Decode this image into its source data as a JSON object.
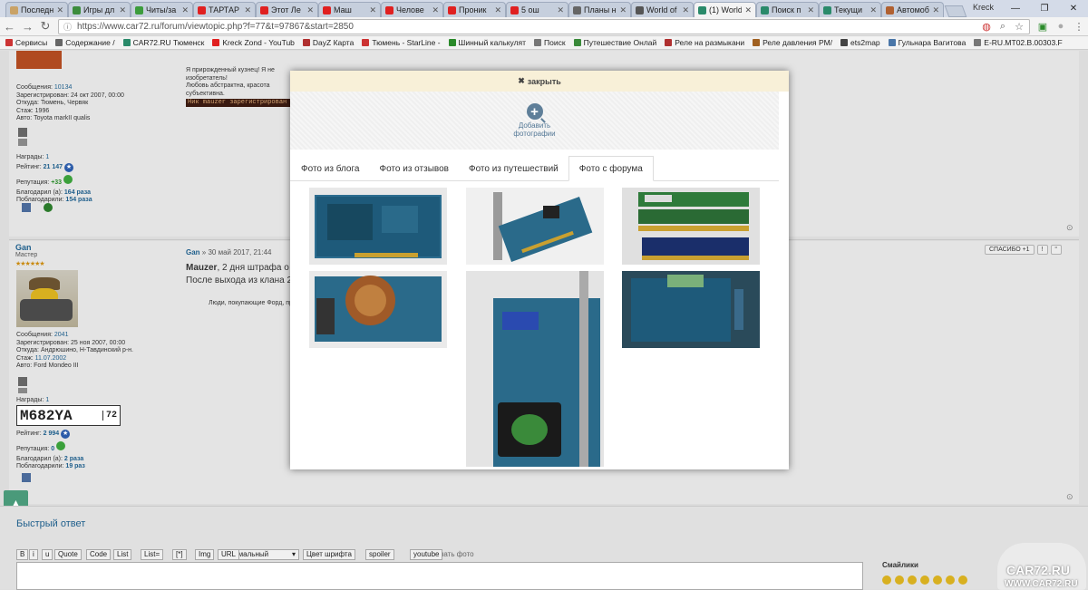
{
  "browser": {
    "tabs": [
      {
        "label": "Последн",
        "color": "#c9a266"
      },
      {
        "label": "Игры дл",
        "color": "#3c8c3c"
      },
      {
        "label": "Читы/за",
        "color": "#3c9c3c"
      },
      {
        "label": "ТАРТАР",
        "color": "#e02020"
      },
      {
        "label": "Этот Ле",
        "color": "#e02020"
      },
      {
        "label": "Маш",
        "color": "#e02020"
      },
      {
        "label": "Челове",
        "color": "#e02020"
      },
      {
        "label": "Проник",
        "color": "#e02020"
      },
      {
        "label": "5 ош",
        "color": "#e02020"
      },
      {
        "label": "Планы н",
        "color": "#666"
      },
      {
        "label": "World of",
        "color": "#555"
      },
      {
        "label": "(1) World",
        "color": "#2a8a6a"
      },
      {
        "label": "Поиск п",
        "color": "#2a8a6a"
      },
      {
        "label": "Текущи",
        "color": "#2a8a6a"
      },
      {
        "label": "Автомоб",
        "color": "#b06030"
      }
    ],
    "active_tab": 11,
    "profile": "Kreck",
    "url": "https://www.car72.ru/forum/viewtopic.php?f=77&t=97867&start=2850",
    "bookmarks": [
      {
        "label": "Сервисы",
        "color": "#c33"
      },
      {
        "label": "Содержание /",
        "color": "#666"
      },
      {
        "label": "CAR72.RU Тюменск",
        "color": "#2a8a6a"
      },
      {
        "label": "Kreck Zond - YouTub",
        "color": "#e02020"
      },
      {
        "label": "DayZ Карта",
        "color": "#b03030"
      },
      {
        "label": "Тюмень - StarLine -",
        "color": "#c33"
      },
      {
        "label": "Шинный калькулят",
        "color": "#2a8a2a"
      },
      {
        "label": "Поиск",
        "color": "#777"
      },
      {
        "label": "Путешествие Онлай",
        "color": "#3a8a3a"
      },
      {
        "label": "Реле на размыкани",
        "color": "#b03030"
      },
      {
        "label": "Реле давления РМ/",
        "color": "#a06020"
      },
      {
        "label": "ets2map",
        "color": "#444"
      },
      {
        "label": "Гульнара Вагитова",
        "color": "#4a76a8"
      },
      {
        "label": "E-RU.MT02.B.00303.F",
        "color": "#777"
      }
    ]
  },
  "forum": {
    "post1": {
      "sig1": "Я прирожденный кузнец! Я не изобретатель!",
      "sig2": "Любовь абстрактна, красота субъективна.",
      "sig3": "Ник mauzer зарегистрирован",
      "messages_label": "Сообщения:",
      "messages": "10134",
      "registered_label": "Зарегистрирован:",
      "registered": "24 окт 2007, 00:00",
      "from_label": "Откуда:",
      "from": "Тюмень, Червяк",
      "exp_label": "Стаж:",
      "exp": "1996",
      "car_label": "Авто:",
      "car": "Toyota markII qualis",
      "awards_label": "Награды:",
      "awards": "1",
      "rating_label": "Рейтинг:",
      "rating": "21 147",
      "rep_label": "Репутация:",
      "rep": "+33",
      "thanked_label": "Благодарил (а):",
      "thanked": "164 раза",
      "got_label": "Поблагодарили:",
      "got": "154 раза"
    },
    "post2": {
      "author": "Gan",
      "rank": "Мастер",
      "date": "» 30 май 2017, 21:44",
      "quote_author": "Mauzer",
      "line1": ", 2 дня штрафа о",
      "line2": "После выхода из клана 2",
      "sig": "Люди, покупающие Форд, прост",
      "messages_label": "Сообщения:",
      "messages": "2041",
      "registered_label": "Зарегистрирован:",
      "registered": "25 ноя 2007, 00:00",
      "from_label": "Откуда:",
      "from": "Андрюшино, Н-Тавдинский р-н.",
      "exp_label": "Стаж:",
      "exp": "11.07.2002",
      "car_label": "Авто:",
      "car": "Ford Mondeo III",
      "awards_label": "Награды:",
      "awards": "1",
      "plate": "M682YA",
      "plate_region": "72",
      "rating_label": "Рейтинг:",
      "rating": "2 994",
      "rep_label": "Репутация:",
      "rep": "0",
      "thanked_label": "Благодарил (а):",
      "thanked": "2 раза",
      "got_label": "Поблагодарили:",
      "got": "19 раз",
      "thanks_button": "СПАСИБО +1"
    },
    "quick_reply": {
      "title": "Быстрый ответ",
      "toolbar": [
        "B",
        "i",
        "u",
        "Quote",
        "Code",
        "List",
        "List=",
        "[*]",
        "Img",
        "URL"
      ],
      "font_size": "Нормальный",
      "toolbar2": [
        "Цвет шрифта",
        "spoiler",
        "youtube"
      ],
      "upload": "Закачать фото",
      "smilies": "Смайлики",
      "brand": "CAR72.RU",
      "brand_url": "WWW.CAR72.RU"
    }
  },
  "modal": {
    "close": "закрыть",
    "add_photos": "Добавить фотографии",
    "tabs": [
      "Фото из блога",
      "Фото из отзывов",
      "Фото из путешествий",
      "Фото с форума"
    ],
    "active_tab": 3
  }
}
